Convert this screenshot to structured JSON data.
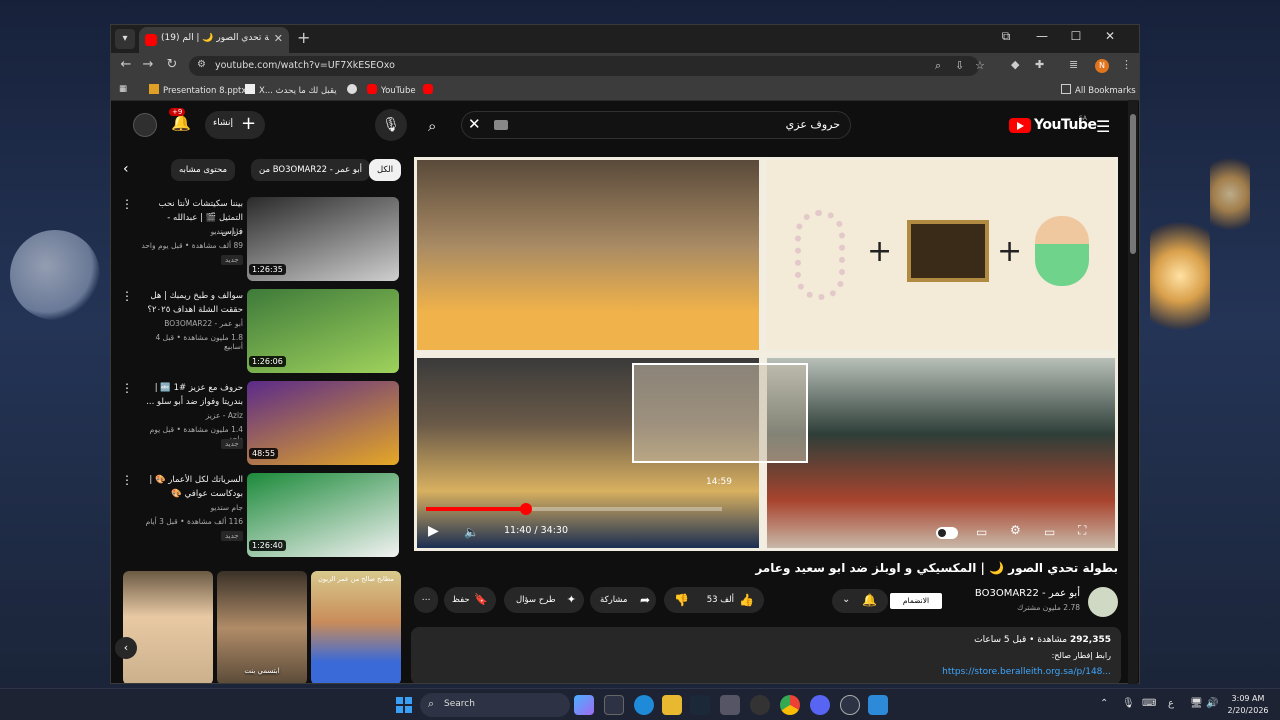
{
  "browser": {
    "tab_title": "(19) بطولة تحدي الصور 🌙 | الم...",
    "url": "youtube.com/watch?v=UF7XkESEOxo",
    "bookmarks": [
      "Presentation 8.pptx",
      "X... يقبل لك ما يحدث",
      "YouTube"
    ],
    "all_bookmarks": "All Bookmarks",
    "profile_initial": "N"
  },
  "youtube": {
    "logo": "YouTube",
    "region": "SA",
    "search_query": "حروف عزي",
    "create_label": "إنشاء",
    "notification_count": "+9",
    "chips": [
      "الكل",
      "من BO3OMAR22 - أبو عمر",
      "محتوى مشابه"
    ]
  },
  "related": [
    {
      "title": "بيننا سكيتشات لأنتا نحب التمثيل 🎬 | عبدالله - فراس...",
      "channel": "جام ستديو",
      "meta": "89 ألف مشاهدة • قبل يوم واحد",
      "badge": "جديد",
      "duration": "1:26:35",
      "colors": [
        "#2a2a2a",
        "#cfcfcf"
      ]
    },
    {
      "title": "سوالف و طبخ ريمبك | هل حققت الشلة اهداف ٢٠٢٥؟",
      "channel": "أبو عمر - BO3OMAR22",
      "meta": "1.8 مليون مشاهدة • قبل 4 أسابيع",
      "badge": "",
      "duration": "1:26:06",
      "colors": [
        "#3e7a3a",
        "#9fd25c"
      ]
    },
    {
      "title": "حروف مع عزيز #1 🔤 | بندريتا وفواز ضد أبو سلو ...",
      "channel": "Aziz - عزيز",
      "meta": "1.4 مليون مشاهدة • قبل يوم واحد",
      "badge": "جديد",
      "duration": "48:55",
      "colors": [
        "#5a2a8a",
        "#e6a826"
      ]
    },
    {
      "title": "السرياتك لكل الأعمار 🎨 | بودكاست عوافي 🎨",
      "channel": "جام ستديو",
      "meta": "116 ألف مشاهدة • قبل 3 أيام",
      "badge": "جديد",
      "duration": "1:26:40",
      "colors": [
        "#1c8a3a",
        "#f2f2f2"
      ]
    }
  ],
  "shorts": [
    {
      "caption": "",
      "top": ""
    },
    {
      "caption": "ابتسمي بنت",
      "top": ""
    },
    {
      "caption": "",
      "top": "مطابخ صالح من عمر الزيون"
    }
  ],
  "player": {
    "current_time": "11:40",
    "duration": "34:30",
    "time_display": "11:40 / 34:30",
    "hover_time": "14:59",
    "progress_fraction": 0.338,
    "hover_fraction": 0.4344
  },
  "video": {
    "title": "بطولة تحدي الصور 🌙 | المكسيكي و اوبلز ضد ابو سعيد وعامر",
    "channel_name": "أبو عمر - BO3OMAR22",
    "subscribers": "2.78 مليون مشترك",
    "join_label": "الانضمام",
    "like_count": "53 ألف",
    "share_label": "مشاركة",
    "ask_label": "طرح سؤال",
    "save_label": "حفظ",
    "views": "292,355",
    "views_suffix": "مشاهدة • قبل 5 ساعات",
    "desc_line": "رابط إفطار صالح:",
    "desc_link": "https://store.beralleith.org.sa/p/148..."
  },
  "taskbar": {
    "search_label": "Search",
    "time": "3:09 AM",
    "date": "2/20/2026",
    "lang": "ع"
  }
}
